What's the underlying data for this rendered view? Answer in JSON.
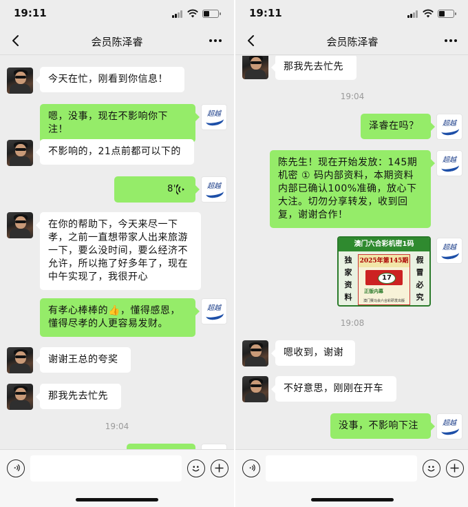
{
  "left": {
    "status": {
      "time": "19:11"
    },
    "nav": {
      "title": "会员陈泽睿"
    },
    "messages": {
      "m1": "今天在忙，刚看到你信息！",
      "m2": "嗯，没事，现在不影响你下注！",
      "m3": "不影响的，21点前都可以下的",
      "m4_duration": "8''",
      "m5": "在你的帮助下，今天来尽一下孝，之前一直想带家人出来旅游一下，要么没时间，要么经济不允许，所以拖了好多年了，现在中午实现了，我很开心",
      "m6": "有孝心棒棒的👍，懂得感恩，懂得尽孝的人更容易发财。",
      "m7": "谢谢王总的夸奖",
      "m8": "那我先去忙先",
      "ts1": "19:04"
    },
    "avatars": {
      "me_text": "超越"
    }
  },
  "right": {
    "status": {
      "time": "19:11"
    },
    "nav": {
      "title": "会员陈泽睿"
    },
    "messages": {
      "m1": "那我先去忙先",
      "ts1": "19:04",
      "m2": "泽睿在吗？",
      "m3": "陈先生！现在开始发放：145期机密 ① 码内部资料，本期资料内部已确认100%准确，放心下大注。切勿分享转发，收到回复，谢谢合作！",
      "ts2": "19:08",
      "m5": "嗯收到，谢谢",
      "m6": "不好意思，刚刚在开车",
      "m7": "没事，不影响下注"
    },
    "image": {
      "header": "澳门六合彩机密1码",
      "left_col": [
        "独",
        "家",
        "资",
        "料"
      ],
      "right_col": [
        "假",
        "冒",
        "必",
        "究"
      ],
      "period": "2025年第145期",
      "number": "17",
      "tag": "正版内幕",
      "footer": "澳门赛马会六合彩研发出版"
    },
    "avatars": {
      "me_text": "超越"
    }
  }
}
